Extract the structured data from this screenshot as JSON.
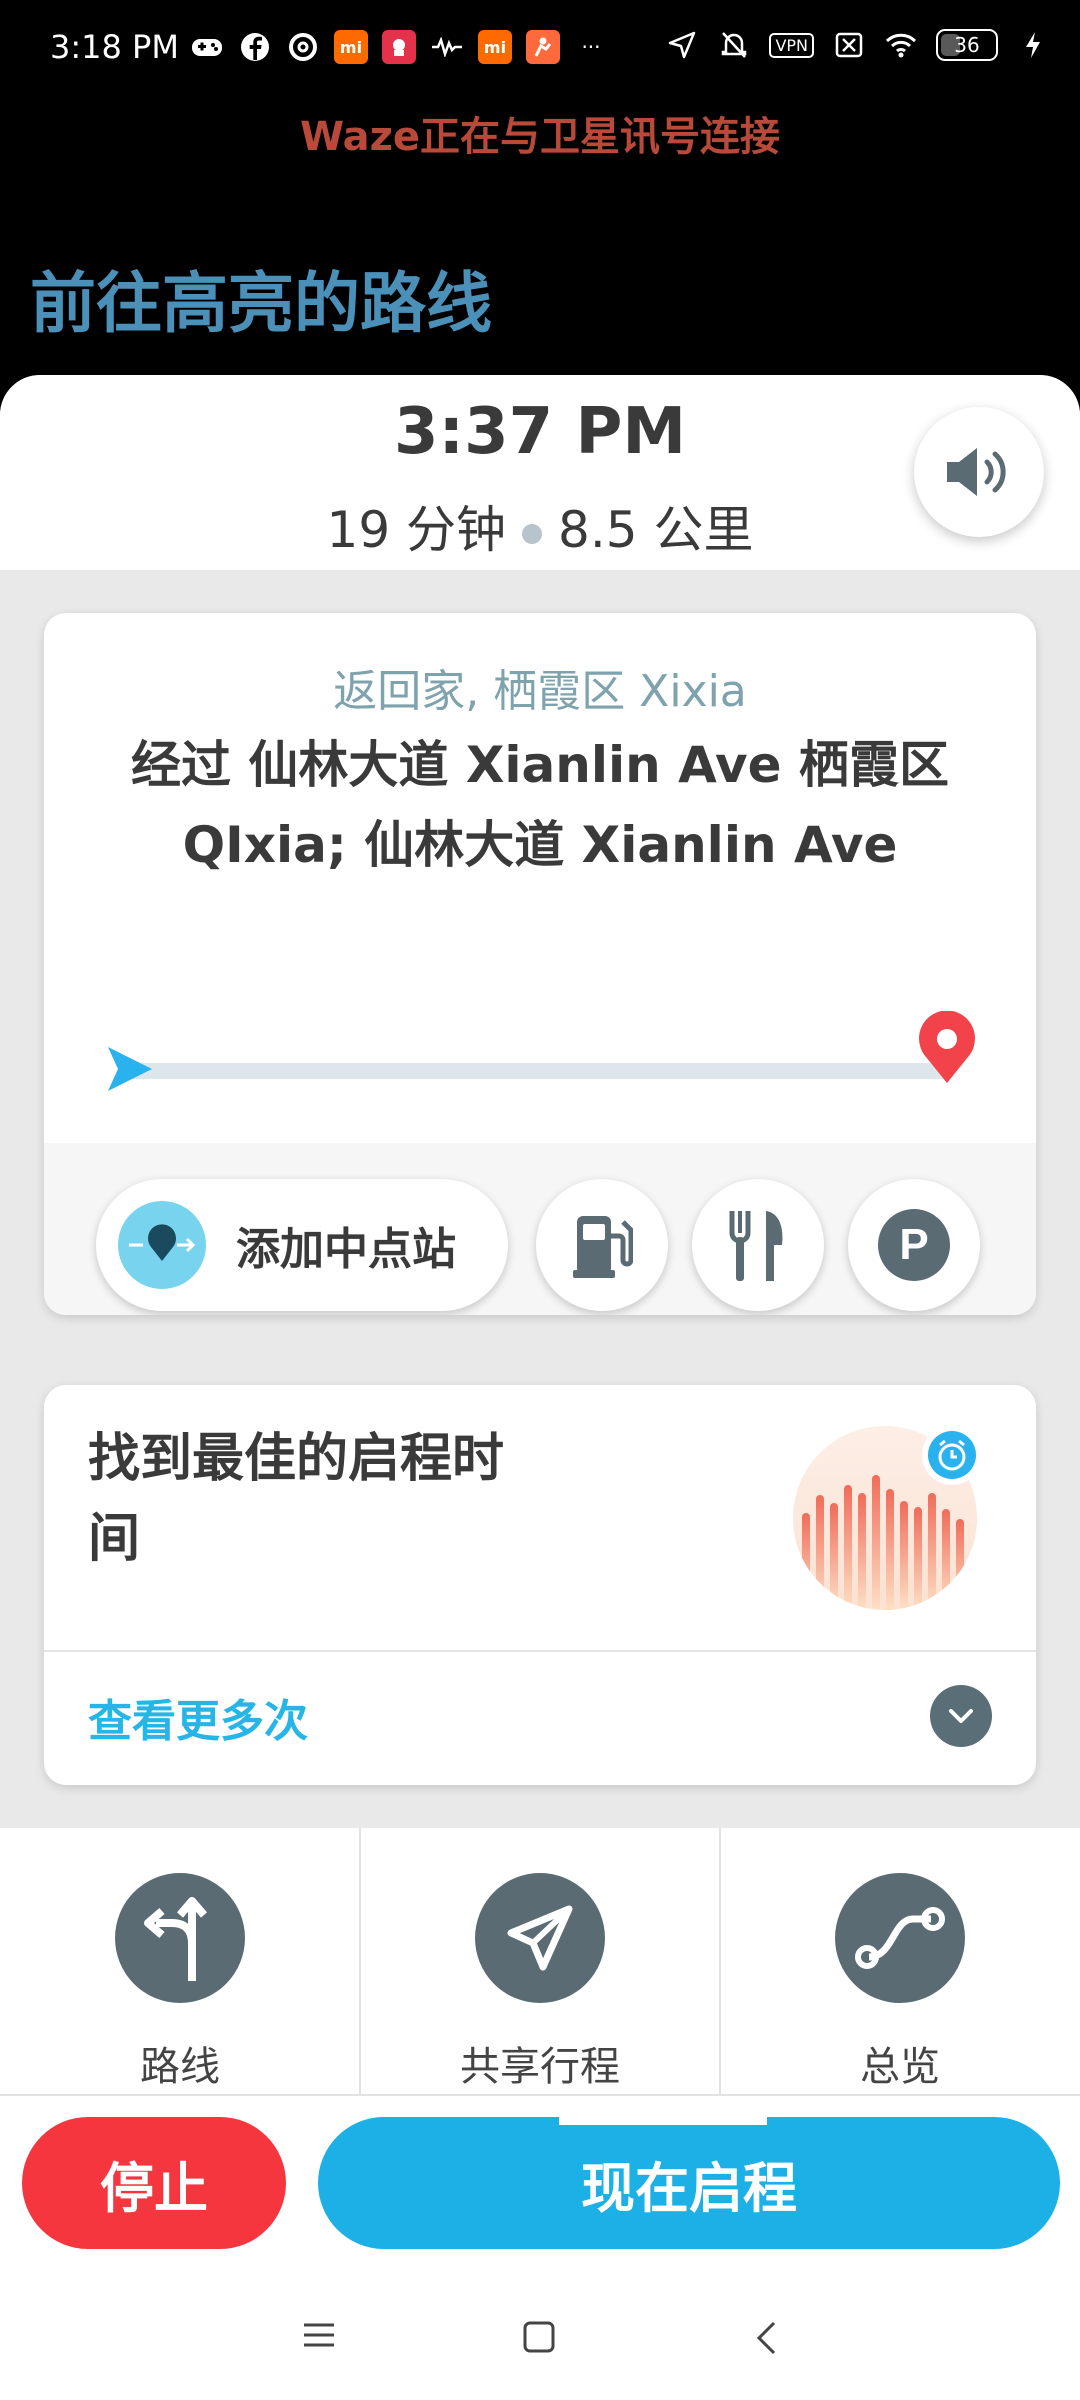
{
  "status_bar": {
    "time": "3:18 PM",
    "left_icons": [
      "game-controller-icon",
      "facebook-icon",
      "threads-icon",
      "mi-app-icon",
      "red-app-icon",
      "waveform-icon",
      "mi-app-icon",
      "orange-app-icon",
      "more-dots-icon"
    ],
    "mi_label": "mi",
    "more_label": "···",
    "vpn_label": "VPN",
    "battery_level": "36",
    "battery_fraction": 0.36
  },
  "gps_status": "Waze正在与卫星讯号连接",
  "page_title": "前往高亮的路线",
  "eta": {
    "arrival_time": "3:37 PM",
    "duration": "19 分钟",
    "distance": "8.5 公里"
  },
  "route": {
    "destination": "返回家, 栖霞区 Xixia",
    "via": "经过 仙林大道 Xianlin Ave 栖霞区 QIxia; 仙林大道 Xianlin Ave",
    "progress_fraction": 0.0
  },
  "route_actions": {
    "add_stop_label": "添加中点站",
    "parking_letter": "P"
  },
  "best_time": {
    "title": "找到最佳的启程时间",
    "more_label": "查看更多次"
  },
  "bottom_nav": [
    {
      "label": "路线",
      "icon": "route-fork-icon"
    },
    {
      "label": "共享行程",
      "icon": "send-arrow-icon"
    },
    {
      "label": "总览",
      "icon": "overview-path-icon"
    }
  ],
  "buttons": {
    "stop": "停止",
    "go": "现在启程",
    "go_countdown_fraction": 0.28
  },
  "colors": {
    "accent_blue": "#1cb0e6",
    "stop_red": "#f5363e",
    "title_blue": "#4a90b8",
    "gps_text": "#b94a3a"
  }
}
